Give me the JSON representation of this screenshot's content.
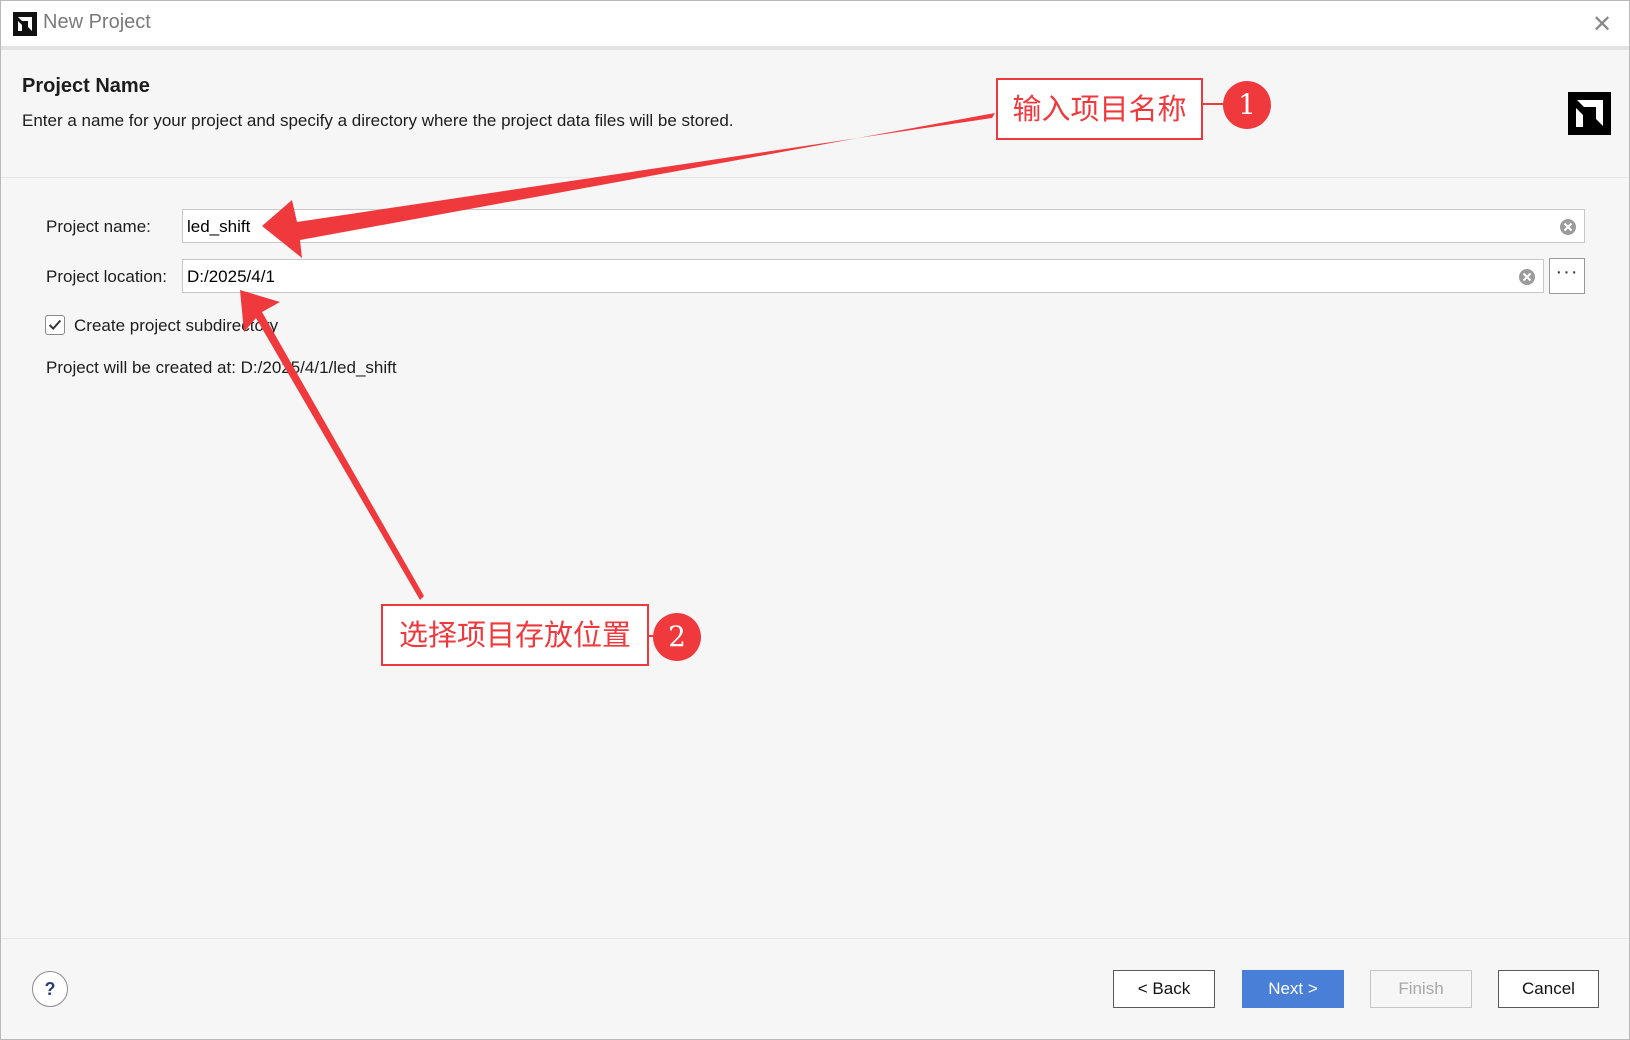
{
  "window": {
    "title": "New Project",
    "close_glyph": "✕"
  },
  "header": {
    "title": "Project Name",
    "subtitle": "Enter a name for your project and specify a directory where the project data files will be stored.",
    "logo_icon": "amd-logo-icon"
  },
  "form": {
    "project_name_label": "Project name:",
    "project_name_value": "led_shift",
    "project_location_label": "Project location:",
    "project_location_value": "D:/2025/4/1",
    "browse_glyph": "···",
    "create_subdirectory_label": "Create project subdirectory",
    "create_subdirectory_checked": true,
    "created_at_text": "Project will be created at: D:/2025/4/1/led_shift"
  },
  "footer": {
    "help_label": "?",
    "back_label": "< Back",
    "next_label": "Next >",
    "finish_label": "Finish",
    "cancel_label": "Cancel"
  },
  "annotations": [
    {
      "text": "输入项目名称",
      "badge": "1"
    },
    {
      "text": "选择项目存放位置",
      "badge": "2"
    }
  ],
  "colors": {
    "annotation_red": "#f0393d",
    "primary_button": "#4a7fd8",
    "background": "#f6f6f6"
  }
}
